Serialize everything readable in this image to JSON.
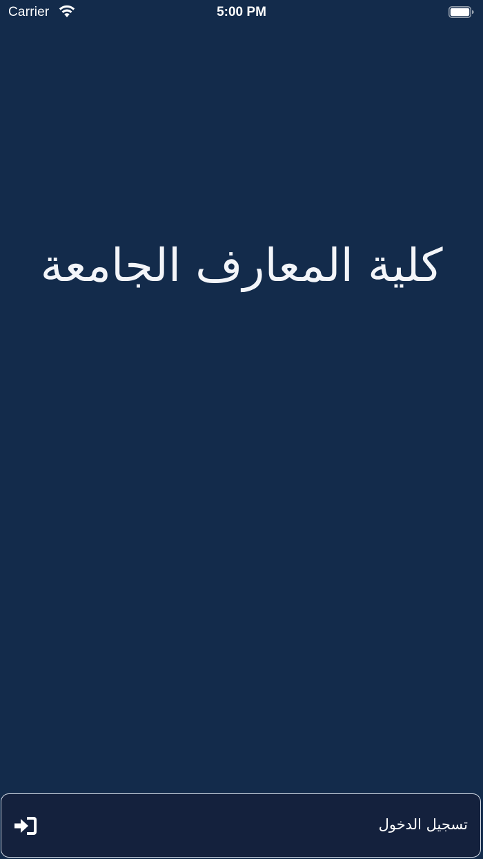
{
  "status_bar": {
    "carrier": "Carrier",
    "time": "5:00 PM",
    "wifi_icon": "wifi-icon",
    "battery_icon": "battery-icon"
  },
  "main": {
    "title": "كلية المعارف الجامعة"
  },
  "login_bar": {
    "label": "تسجيل الدخول",
    "icon": "sign-in-icon"
  },
  "colors": {
    "background": "#132b4b",
    "login_bar_background": "#14213d",
    "login_bar_border": "#d4dbe6",
    "text": "#ffffff"
  }
}
